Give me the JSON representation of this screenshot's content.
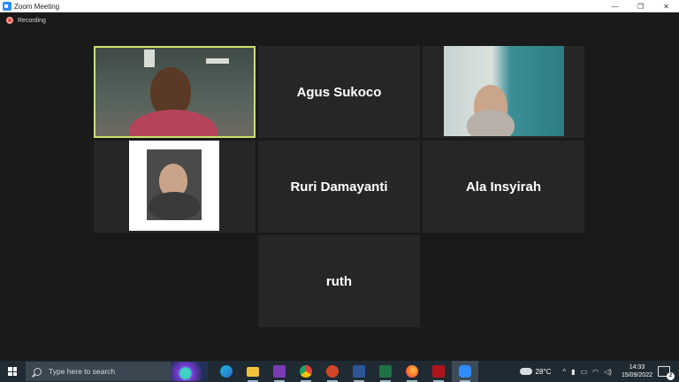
{
  "window": {
    "title": "Zoom Meeting",
    "controls": {
      "minimize": "—",
      "restore": "❐",
      "close": "✕"
    }
  },
  "recording": {
    "label": "Recording"
  },
  "participants": [
    {
      "name": "",
      "has_video": true
    },
    {
      "name": "Agus Sukoco",
      "has_video": false
    },
    {
      "name": "",
      "has_video": true
    },
    {
      "name": "",
      "has_video": true
    },
    {
      "name": "Ruri Damayanti",
      "has_video": false
    },
    {
      "name": "Ala Insyirah",
      "has_video": false
    },
    {
      "name": "ruth",
      "has_video": false
    }
  ],
  "taskbar": {
    "search_placeholder": "Type here to search",
    "apps": [
      "edge-icon",
      "file-explorer-icon",
      "onenote-icon",
      "chrome-icon",
      "powerpoint-icon",
      "word-icon",
      "excel-icon",
      "firefox-icon",
      "mendeley-icon",
      "zoom-icon"
    ],
    "weather": {
      "temp": "28°C"
    },
    "clock": {
      "time": "14:33",
      "date": "15/09/2022"
    },
    "notification_count": "2",
    "colors": {
      "accent": "#2d8cff",
      "taskbar": "#1f2a33"
    }
  }
}
